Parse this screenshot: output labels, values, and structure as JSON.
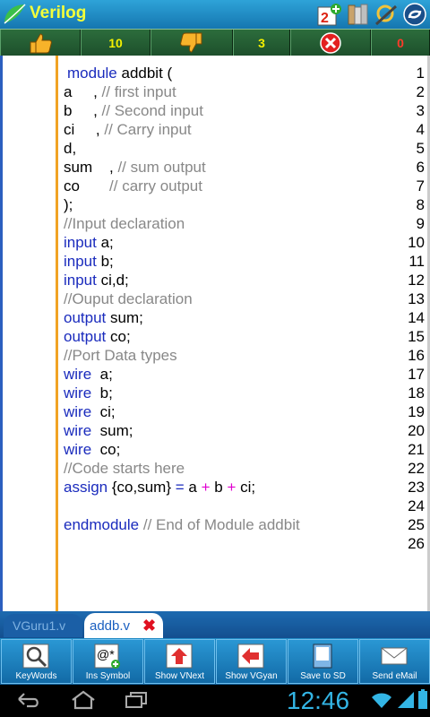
{
  "app": {
    "title": "Verilog"
  },
  "votebar": {
    "likes": "10",
    "dislikes": "3",
    "errors": "0"
  },
  "editor": {
    "line_numbers": [
      "1",
      "2",
      "3",
      "4",
      "5",
      "6",
      "7",
      "8",
      "9",
      "10",
      "11",
      "12",
      "13",
      "14",
      "15",
      "16",
      "17",
      "18",
      "19",
      "20",
      "21",
      "22",
      "23",
      "24",
      "25",
      "26"
    ]
  },
  "code": {
    "l1_kw": "module",
    "l1_rest": " addbit (",
    "l2_a": "a     ,",
    "l2_cm": " // first input",
    "l3_a": "b     ,",
    "l3_cm": " // Second input",
    "l4_a": "ci     ,",
    "l4_cm": " // Carry input",
    "l5": "d,",
    "l6_a": "sum    ,",
    "l6_cm": " // sum output",
    "l7_a": "co      ",
    "l7_cm": " // carry output",
    "l8": ");",
    "l9_cm": "//Input declaration",
    "l10_kw": "input",
    "l10_rest": " a;",
    "l11_kw": "input",
    "l11_rest": " b;",
    "l12_kw": "input",
    "l12_rest": " ci,d;",
    "l13_cm": "//Ouput declaration",
    "l14_kw": "output",
    "l14_rest": " sum;",
    "l15_kw": "output",
    "l15_rest": " co;",
    "l16_cm": "//Port Data types",
    "l17_kw": "wire",
    "l17_rest": "  a;",
    "l18_kw": "wire",
    "l18_rest": "  b;",
    "l19_kw": "wire",
    "l19_rest": "  ci;",
    "l20_kw": "wire",
    "l20_rest": "  sum;",
    "l21_kw": "wire",
    "l21_rest": "  co;",
    "l22_cm": "//Code starts here",
    "l23_kw": "assign",
    "l23_a": " {co,sum} ",
    "l23_eq": "=",
    "l23_b": " a ",
    "l23_p1": "+",
    "l23_c": " b ",
    "l23_p2": "+",
    "l23_d": " ci;",
    "l25_kw": "endmodule",
    "l25_cm": " // End of Module addbit"
  },
  "tabs": {
    "tab1": "VGuru1.v",
    "tab2": "addb.v",
    "close": "✖"
  },
  "toolbar": {
    "keywords": "KeyWords",
    "ins_symbol": "Ins Symbol",
    "show_vnext": "Show VNext",
    "show_vgyan": "Show VGyan",
    "save_sd": "Save to SD",
    "send_email": "Send eMail"
  },
  "status": {
    "time": "12:46"
  },
  "colors": {
    "keyword": "#1a2bbd",
    "comment": "#888888",
    "operator": "#e000d0",
    "accent": "#f1a324"
  }
}
